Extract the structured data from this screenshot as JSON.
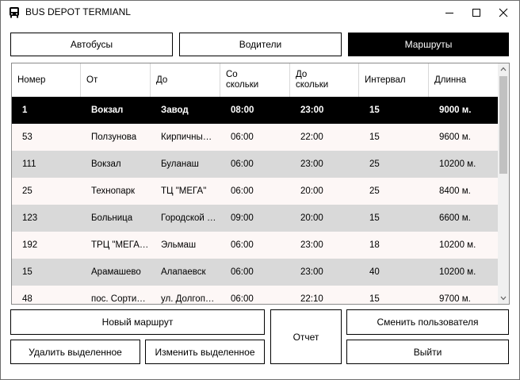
{
  "window": {
    "title": "BUS DEPOT TERMIANL"
  },
  "tabs": [
    {
      "label": "Автобусы"
    },
    {
      "label": "Водители"
    },
    {
      "label": "Маршруты"
    }
  ],
  "table": {
    "columns": [
      "Номер",
      "От",
      "До",
      "Со\nскольки",
      "До\nскольки",
      "Интервал",
      "Длинна"
    ],
    "rows": [
      [
        "1",
        "Вокзал",
        "Завод",
        "08:00",
        "23:00",
        "15",
        "9000 м."
      ],
      [
        "53",
        "Ползунова",
        "Кирпичны…",
        "06:00",
        "22:00",
        "15",
        "9600 м."
      ],
      [
        "111",
        "Вокзал",
        "Буланаш",
        "06:00",
        "23:00",
        "25",
        "10200 м."
      ],
      [
        "25",
        "Технопарк",
        "ТЦ \"МЕГА\"",
        "06:00",
        "20:00",
        "25",
        "8400 м."
      ],
      [
        "123",
        "Больница",
        "Городской …",
        "09:00",
        "20:00",
        "15",
        "6600 м."
      ],
      [
        "192",
        "ТРЦ \"МЕГА…",
        "Эльмаш",
        "06:00",
        "23:00",
        "18",
        "10200 м."
      ],
      [
        "15",
        "Арамашево",
        "Алапаевск",
        "06:00",
        "23:00",
        "40",
        "10200 м."
      ],
      [
        "48",
        "пос. Сорти…",
        "ул. Долгоп…",
        "06:00",
        "22:10",
        "15",
        "9700 м."
      ]
    ]
  },
  "buttons": {
    "new_route": "Новый маршрут",
    "delete_selected": "Удалить выделенное",
    "edit_selected": "Изменить выделенное",
    "report": "Отчет",
    "switch_user": "Сменить пользователя",
    "exit": "Выйти"
  },
  "colors": {
    "selected_row": "#000000",
    "row_light": "#fdf7f6",
    "row_gray": "#d9d9d9"
  },
  "icons": [
    "bus-icon",
    "minimize-icon",
    "maximize-icon",
    "close-icon",
    "scroll-up-icon",
    "scroll-down-icon"
  ]
}
